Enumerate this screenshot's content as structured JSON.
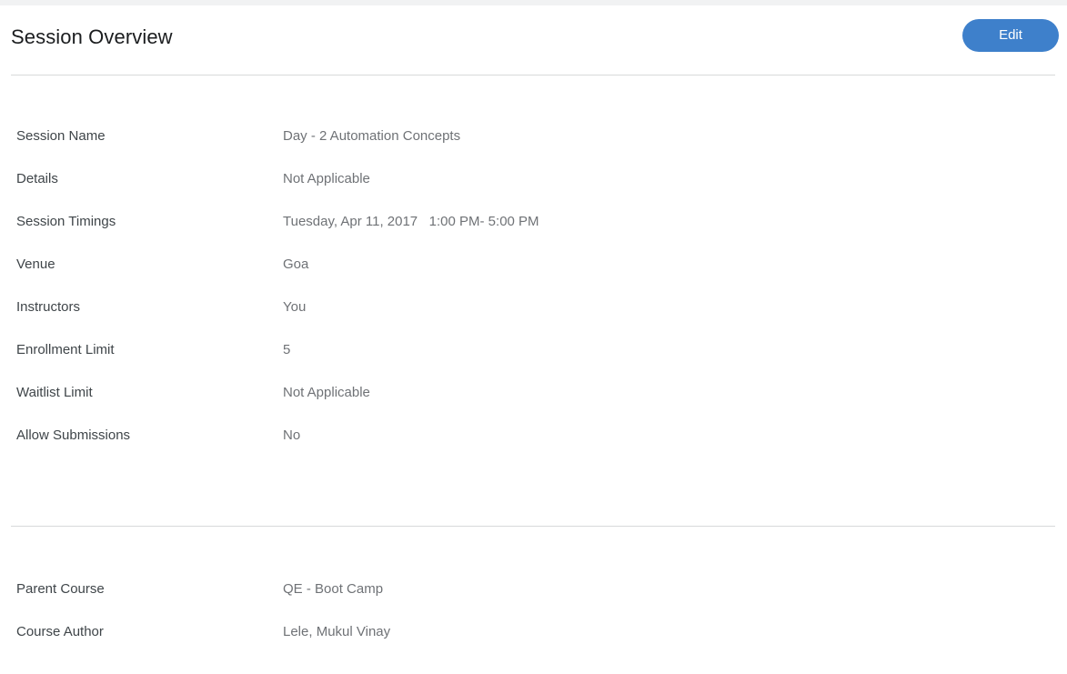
{
  "header": {
    "title": "Session Overview",
    "edit_label": "Edit",
    "accent_color": "#3e80cb"
  },
  "session_details": {
    "rows": [
      {
        "label": "Session Name",
        "value": "Day - 2 Automation Concepts"
      },
      {
        "label": "Details",
        "value": "Not Applicable"
      },
      {
        "label": "Session Timings",
        "value": "Tuesday, Apr 11, 2017   1:00 PM- 5:00 PM"
      },
      {
        "label": "Venue",
        "value": "Goa"
      },
      {
        "label": "Instructors",
        "value": "You"
      },
      {
        "label": "Enrollment Limit",
        "value": "5"
      },
      {
        "label": "Waitlist Limit",
        "value": "Not Applicable"
      },
      {
        "label": "Allow Submissions",
        "value": "No"
      }
    ]
  },
  "course_details": {
    "rows": [
      {
        "label": "Parent Course",
        "value": "QE - Boot Camp"
      },
      {
        "label": "Course Author",
        "value": "Lele, Mukul Vinay"
      }
    ]
  }
}
